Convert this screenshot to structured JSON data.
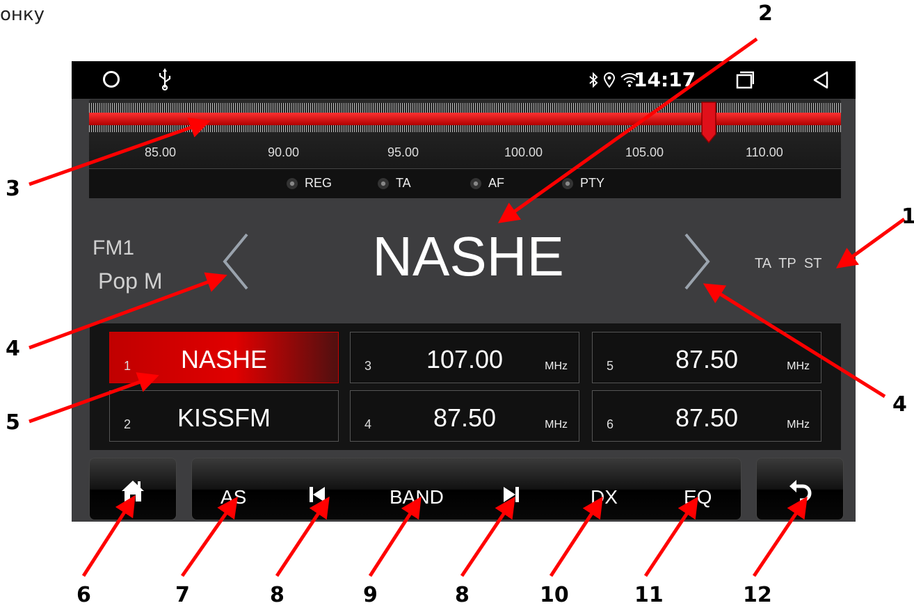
{
  "fragment_text": "онку",
  "status_bar": {
    "time": "14:17",
    "icons": [
      "home-circle-icon",
      "usb-icon",
      "bluetooth-icon",
      "location-icon",
      "wifi-icon",
      "recent-apps-icon",
      "back-triangle-icon"
    ]
  },
  "tuner": {
    "ticks": [
      "85.00",
      "90.00",
      "95.00",
      "100.00",
      "105.00",
      "110.00"
    ],
    "rds_options": [
      "REG",
      "TA",
      "AF",
      "PTY"
    ],
    "accent_color": "#e00000"
  },
  "station": {
    "band": "FM1",
    "pty": "Pop M",
    "name": "NASHE",
    "flags": "TA TP ST"
  },
  "presets": [
    {
      "number": "1",
      "label": "NASHE",
      "unit": "",
      "active": true
    },
    {
      "number": "2",
      "label": "KISSFM",
      "unit": "",
      "active": false
    },
    {
      "number": "3",
      "label": "107.00",
      "unit": "MHz",
      "active": false
    },
    {
      "number": "4",
      "label": "87.50",
      "unit": "MHz",
      "active": false
    },
    {
      "number": "5",
      "label": "87.50",
      "unit": "MHz",
      "active": false
    },
    {
      "number": "6",
      "label": "87.50",
      "unit": "MHz",
      "active": false
    }
  ],
  "bottom_bar": {
    "home_icon": "home-icon",
    "as_label": "AS",
    "prev_icon": "skip-previous-icon",
    "band_label": "BAND",
    "next_icon": "skip-next-icon",
    "dx_label": "DX",
    "eq_label": "EQ",
    "back_icon": "undo-back-icon"
  },
  "annotations": {
    "n1": "1",
    "n2": "2",
    "n3": "3",
    "n4a": "4",
    "n4b": "4",
    "n5": "5",
    "n6": "6",
    "n7": "7",
    "n8a": "8",
    "n9": "9",
    "n8b": "8",
    "n10": "10",
    "n11": "11",
    "n12": "12",
    "arrow_color": "#ff0000"
  }
}
